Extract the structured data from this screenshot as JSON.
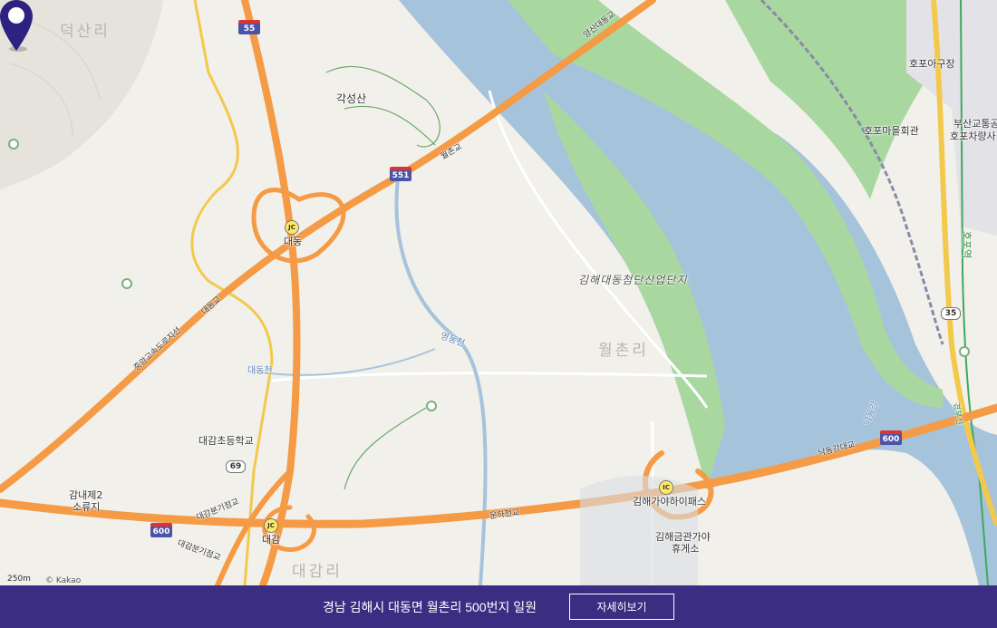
{
  "map": {
    "place_names": {
      "deoksan": "덕산리",
      "wolchon": "월촌리",
      "daegam": "대감리"
    },
    "labels": {
      "gakseongsan": "각성산",
      "daedong_jc": "대동",
      "daegam_jc": "대감",
      "hopo_depot": "호포아구장",
      "hopo_hall": "호포마을회관",
      "busan_transit": "부산교통공",
      "hopo_depot2": "호포차량사",
      "hopo_station": "호포역",
      "daegam_school": "대감초등학교",
      "gamnae": "감내제2",
      "gamnae2": "소류지",
      "gimhae_ic": "김해가야하이패스",
      "rest_area": "김해금관가야",
      "rest_area2": "휴게소",
      "complex": "김해대동첨단산업단지"
    },
    "roads": {
      "yangsan": "양산대동교",
      "wolchon_bridge": "월촌교",
      "jungang": "중앙고속도로지선",
      "daedong_road": "대동교",
      "yeongdong": "영동천",
      "daedong_stream": "대동천",
      "nakdong": "낙동강",
      "nakdong_bridge": "낙동강대교",
      "unha": "운하천교",
      "daegam_bunggi": "대감분기점교",
      "daegam_bunggi2": "대감분기점교",
      "gyeongbu": "경부선"
    },
    "shields": {
      "r55": "55",
      "r551": "551",
      "r600a": "600",
      "r600b": "600",
      "r69": "69",
      "r35": "35"
    },
    "jc_marks": {
      "jc1": "JC",
      "jc2": "JC",
      "ic1": "IC"
    },
    "scale": "250m",
    "copyright": "© Kakao"
  },
  "footer": {
    "address": "경남 김해시 대동면 월촌리 500번지 일원",
    "detail_button": "자세히보기"
  },
  "colors": {
    "footer_bg": "#3a2d82",
    "river": "#a6c3dc",
    "green": "#a8d8a0",
    "highway": "#f59a45",
    "pin": "#2d2280"
  }
}
